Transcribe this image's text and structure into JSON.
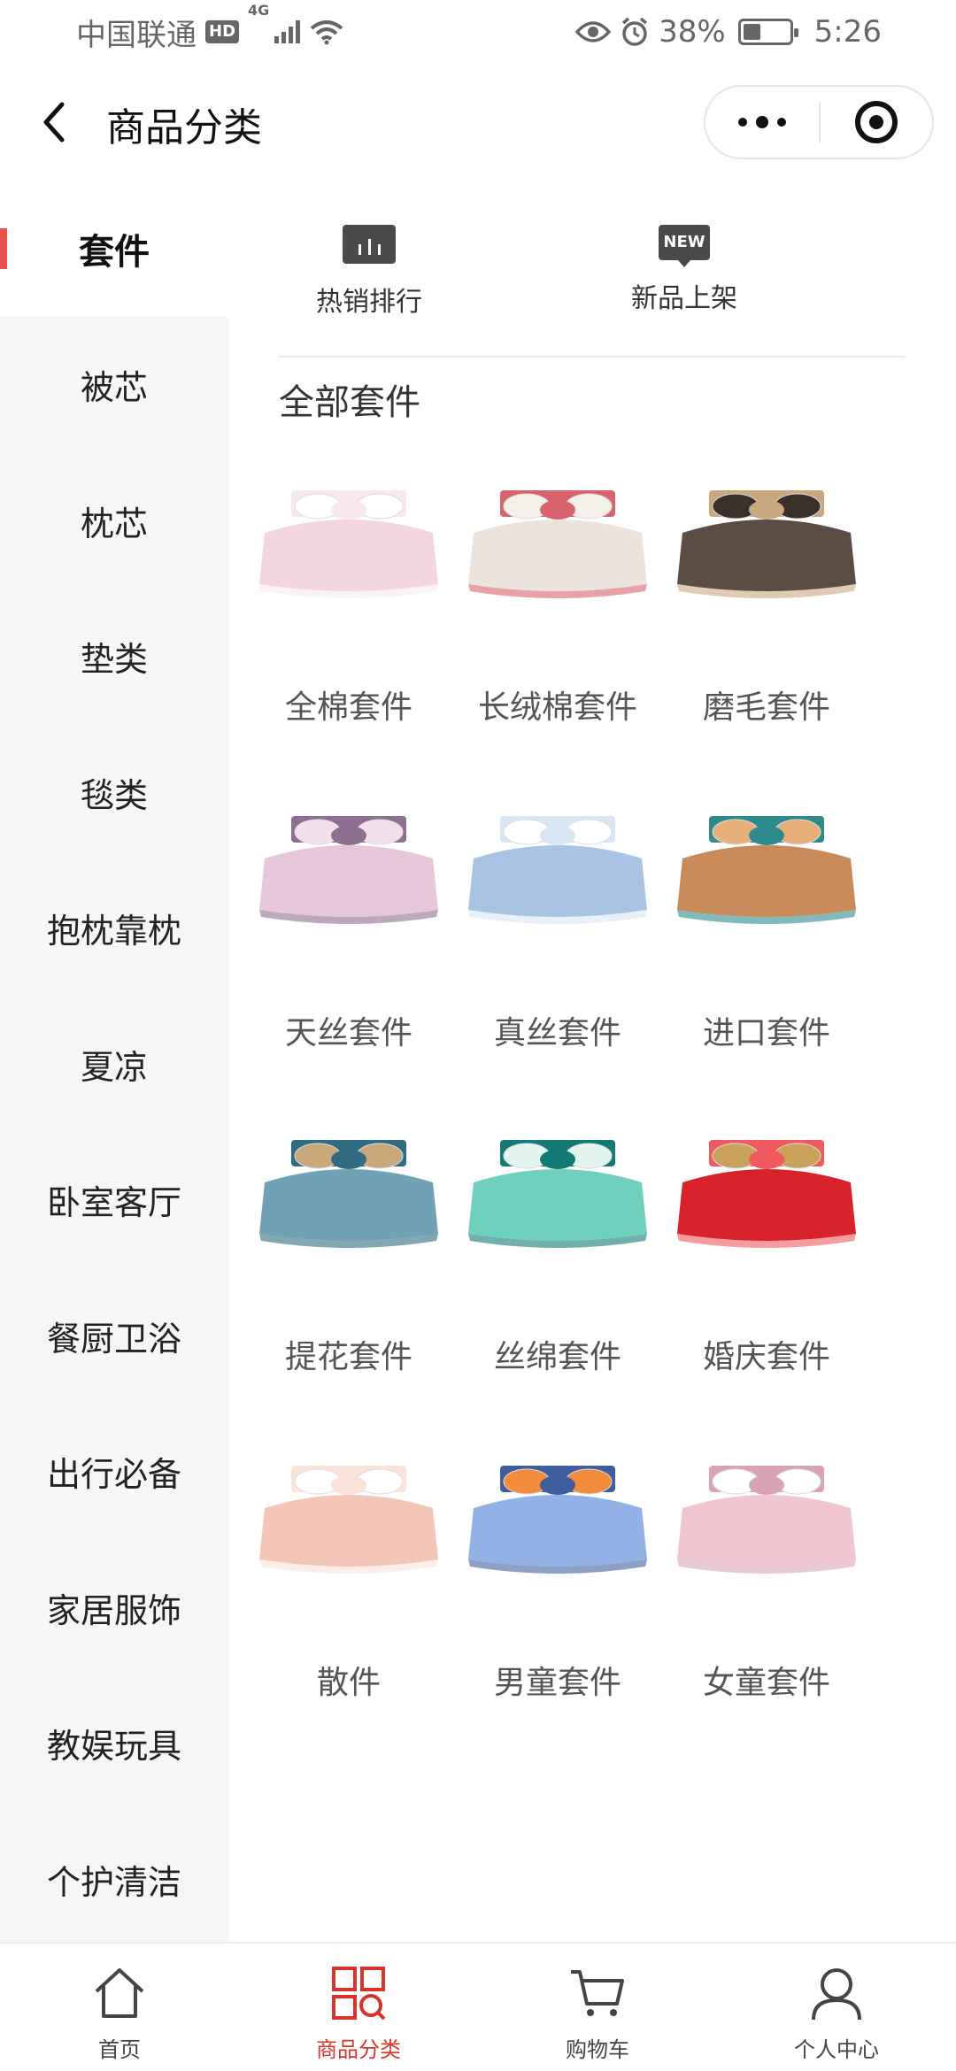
{
  "status_bar": {
    "carrier": "中国联通",
    "hd": "HD",
    "network": "4G",
    "battery_percent": "38%",
    "battery_level": 0.38,
    "time": "5:26"
  },
  "nav": {
    "title": "商品分类"
  },
  "sidebar": {
    "items": [
      {
        "label": "套件",
        "active": true
      },
      {
        "label": "被芯"
      },
      {
        "label": "枕芯"
      },
      {
        "label": "垫类"
      },
      {
        "label": "毯类"
      },
      {
        "label": "抱枕靠枕"
      },
      {
        "label": "夏凉"
      },
      {
        "label": "卧室客厅"
      },
      {
        "label": "餐厨卫浴"
      },
      {
        "label": "出行必备"
      },
      {
        "label": "家居服饰"
      },
      {
        "label": "教娱玩具"
      },
      {
        "label": "个护清洁"
      }
    ]
  },
  "quick_links": [
    {
      "label": "热销排行",
      "icon": "chart-bars-icon"
    },
    {
      "label": "新品上架",
      "icon": "new-badge-icon",
      "badge": "NEW"
    }
  ],
  "section": {
    "title": "全部套件",
    "items": [
      {
        "label": "全棉套件",
        "colors": [
          "#f4d6df",
          "#f9e9ee",
          "#ffffff"
        ]
      },
      {
        "label": "长绒棉套件",
        "colors": [
          "#ece4dc",
          "#d9636d",
          "#f4efe9"
        ]
      },
      {
        "label": "磨毛套件",
        "colors": [
          "#5b4c44",
          "#c9a77f",
          "#3a3029"
        ]
      },
      {
        "label": "天丝套件",
        "colors": [
          "#e6c6d8",
          "#8d6f92",
          "#f3dfe9"
        ]
      },
      {
        "label": "真丝套件",
        "colors": [
          "#a8c3e4",
          "#d8e6f5",
          "#ffffff"
        ]
      },
      {
        "label": "进口套件",
        "colors": [
          "#c98a5a",
          "#2e8a8c",
          "#e7b07a"
        ]
      },
      {
        "label": "提花套件",
        "colors": [
          "#6fa2b4",
          "#2f6c82",
          "#c9a87b"
        ]
      },
      {
        "label": "丝绵套件",
        "colors": [
          "#6fd1bd",
          "#137a75",
          "#e2f5f1"
        ]
      },
      {
        "label": "婚庆套件",
        "colors": [
          "#d8232a",
          "#f05a5f",
          "#c8a15a"
        ]
      },
      {
        "label": "散件",
        "colors": [
          "#f3c5b6",
          "#fbe3da",
          "#ffffff"
        ]
      },
      {
        "label": "男童套件",
        "colors": [
          "#92b2e6",
          "#3f5f9c",
          "#f08c3c"
        ]
      },
      {
        "label": "女童套件",
        "colors": [
          "#efc6cf",
          "#d8a3b4",
          "#ffffff"
        ]
      }
    ]
  },
  "tabbar": {
    "items": [
      {
        "label": "首页",
        "icon": "home-icon"
      },
      {
        "label": "商品分类",
        "icon": "category-icon",
        "active": true
      },
      {
        "label": "购物车",
        "icon": "cart-icon"
      },
      {
        "label": "个人中心",
        "icon": "person-icon"
      }
    ]
  },
  "colors": {
    "accent": "#e8514b",
    "tab_active": "#d9342b"
  }
}
